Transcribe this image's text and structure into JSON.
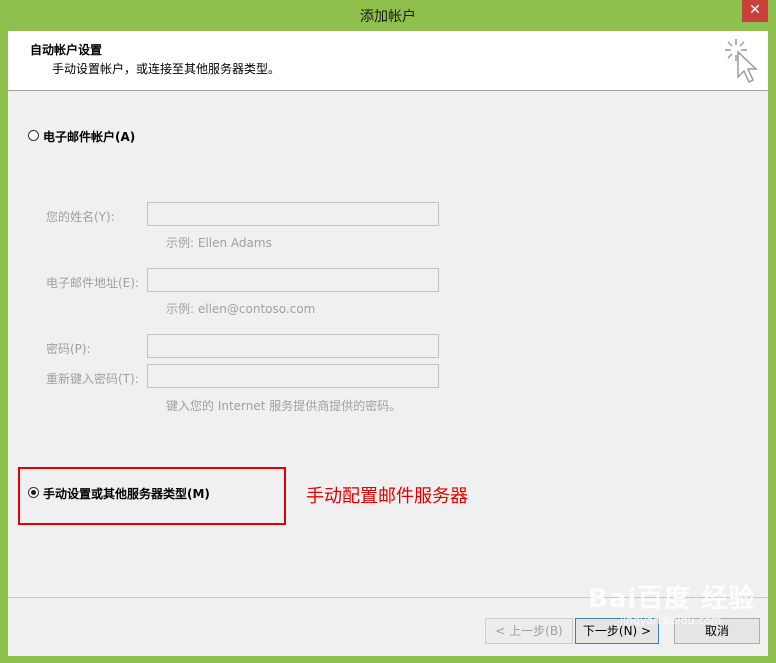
{
  "window": {
    "title": "添加帐户",
    "close_glyph": "✕"
  },
  "header": {
    "title": "自动帐户设置",
    "subtitle": "手动设置帐户，或连接至其他服务器类型。"
  },
  "options": {
    "email_account": {
      "label": "电子邮件帐户(A)",
      "checked": false
    },
    "manual": {
      "label": "手动设置或其他服务器类型(M)",
      "checked": true
    }
  },
  "fields": {
    "name": {
      "label": "您的姓名(Y):",
      "value": "",
      "hint": "示例: Ellen Adams"
    },
    "email": {
      "label": "电子邮件地址(E):",
      "value": "",
      "hint": "示例: ellen@contoso.com"
    },
    "password": {
      "label": "密码(P):",
      "value": ""
    },
    "retype": {
      "label": "重新键入密码(T):",
      "value": "",
      "hint": "键入您的 Internet 服务提供商提供的密码。"
    }
  },
  "annotation": {
    "text": "手动配置邮件服务器",
    "color": "#e00000"
  },
  "buttons": {
    "back": "< 上一步(B)",
    "next": "下一步(N) >",
    "cancel": "取消"
  },
  "icons": {
    "header_icon": "magic-wand-cursor-icon",
    "close": "close-icon"
  },
  "watermark": {
    "text": "Bai百度 经验",
    "sub": "jingyan.baidu.com"
  }
}
